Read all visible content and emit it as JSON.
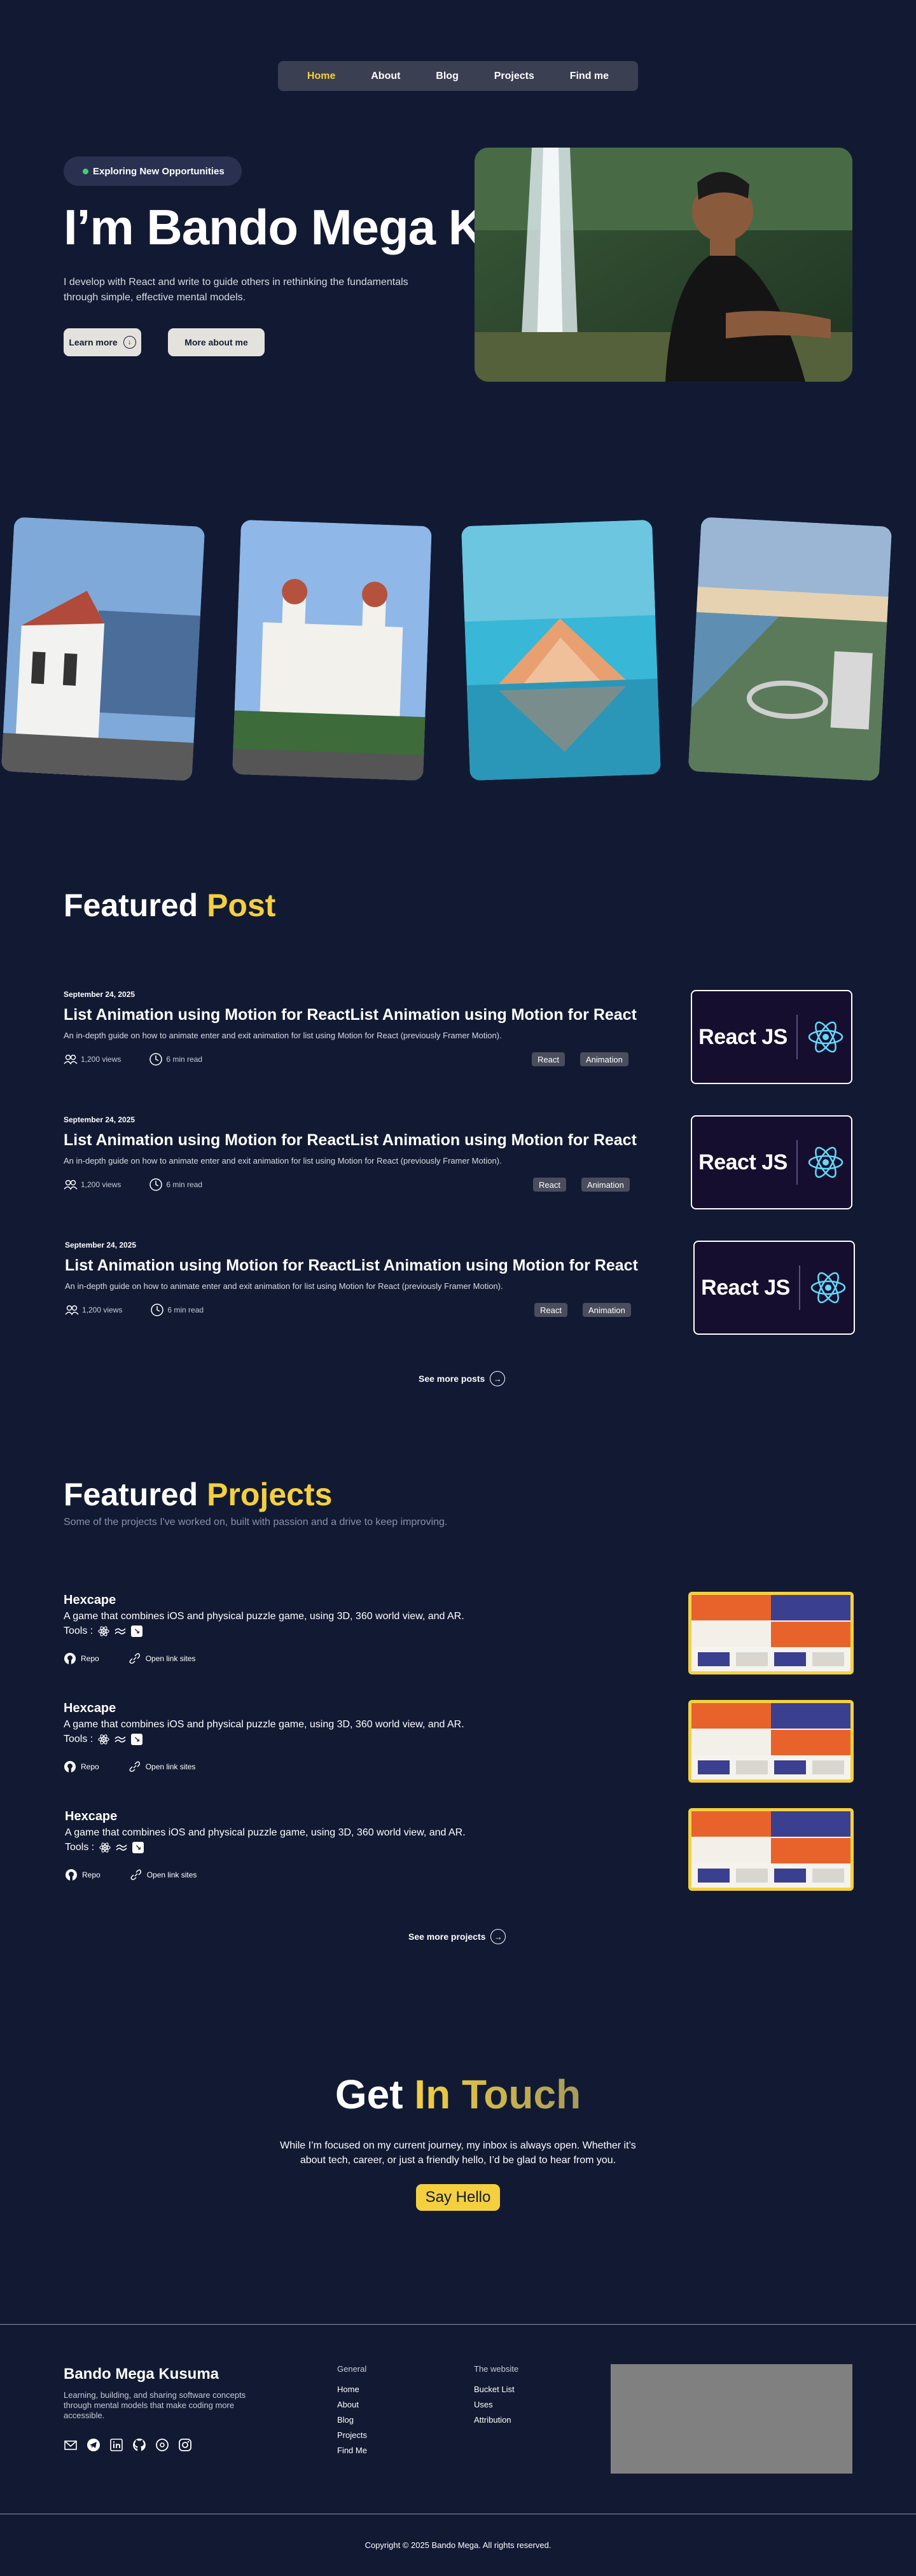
{
  "nav": {
    "items": [
      {
        "label": "Home",
        "active": true
      },
      {
        "label": "About"
      },
      {
        "label": "Blog"
      },
      {
        "label": "Projects"
      },
      {
        "label": "Find me"
      }
    ]
  },
  "hero": {
    "badge": "Exploring New Opportunities",
    "title": "I’m Bando Mega K",
    "description": "I develop with React and write to guide others in rethinking the fundamentals through simple, effective mental models.",
    "learn_more": "Learn more",
    "more_about": "More about me",
    "photo_icon": "portrait-photo"
  },
  "gallery": {
    "images": [
      "white-colonial-building",
      "lawang-sewu-building",
      "pyramid-building-by-sea",
      "aerial-coastal-city"
    ]
  },
  "featured_post": {
    "title_white": "Featured",
    "title_yellow": "Post",
    "posts": [
      {
        "date": "September 24, 2025",
        "title": "List Animation using Motion for ReactList Animation using Motion for React",
        "description": "An in-depth guide on how to animate enter and exit animation for list using Motion for React (previously Framer Motion).",
        "views": "1,200 views",
        "read_time": "6 min read",
        "tags": [
          "React",
          "Animation"
        ],
        "thumb_text": "React JS"
      },
      {
        "date": "September 24, 2025",
        "title": "List Animation using Motion for ReactList Animation using Motion for React",
        "description": "An in-depth guide on how to animate enter and exit animation for list using Motion for React (previously Framer Motion).",
        "views": "1,200 views",
        "read_time": "6 min read",
        "tags": [
          "React",
          "Animation"
        ],
        "thumb_text": "React JS"
      },
      {
        "date": "September 24, 2025",
        "title": "List Animation using Motion for ReactList Animation using Motion for React",
        "description": "An in-depth guide on how to animate enter and exit animation for list using Motion for React (previously Framer Motion).",
        "views": "1,200 views",
        "read_time": "6 min read",
        "tags": [
          "React",
          "Animation"
        ],
        "thumb_text": "React JS"
      }
    ],
    "see_more": "See more posts"
  },
  "featured_projects": {
    "title_white": "Featured",
    "title_yellow": "Projects",
    "subtitle": "Some of the projects I've worked on, built with passion and a drive to keep improving.",
    "projects": [
      {
        "title": "Hexcape",
        "description": "A game that combines iOS and physical puzzle game, using 3D, 360 world view, and AR.",
        "tools_label": "Tools :",
        "repo": "Repo",
        "open_link": "Open link sites"
      },
      {
        "title": "Hexcape",
        "description": "A game that combines iOS and physical puzzle game, using 3D, 360 world view, and AR.",
        "tools_label": "Tools :",
        "repo": "Repo",
        "open_link": "Open link sites"
      },
      {
        "title": "Hexcape",
        "description": "A game that combines iOS and physical puzzle game, using 3D, 360 world view, and AR.",
        "tools_label": "Tools :",
        "repo": "Repo",
        "open_link": "Open link sites"
      }
    ],
    "see_more": "See more projects"
  },
  "contact": {
    "title_white": "Get",
    "title_yellow": "In Touch",
    "text": "While I’m focused on my current journey, my inbox is always open. Whether it’s about tech, career, or just a friendly hello, I’d be glad to hear from you.",
    "button": "Say Hello"
  },
  "footer": {
    "name": "Bando Mega Kusuma",
    "description": "Learning, building, and sharing software concepts through mental models that make coding more accessible.",
    "general_heading": "General",
    "general_links": [
      "Home",
      "About",
      "Blog",
      "Projects",
      "Find Me"
    ],
    "website_heading": "The website",
    "website_links": [
      "Bucket List",
      "Uses",
      "Attribution"
    ],
    "copyright": "Copyright © 2025 Bando Mega. All rights reserved."
  },
  "colors": {
    "background": "#121a33",
    "accent": "#f4d03f"
  }
}
